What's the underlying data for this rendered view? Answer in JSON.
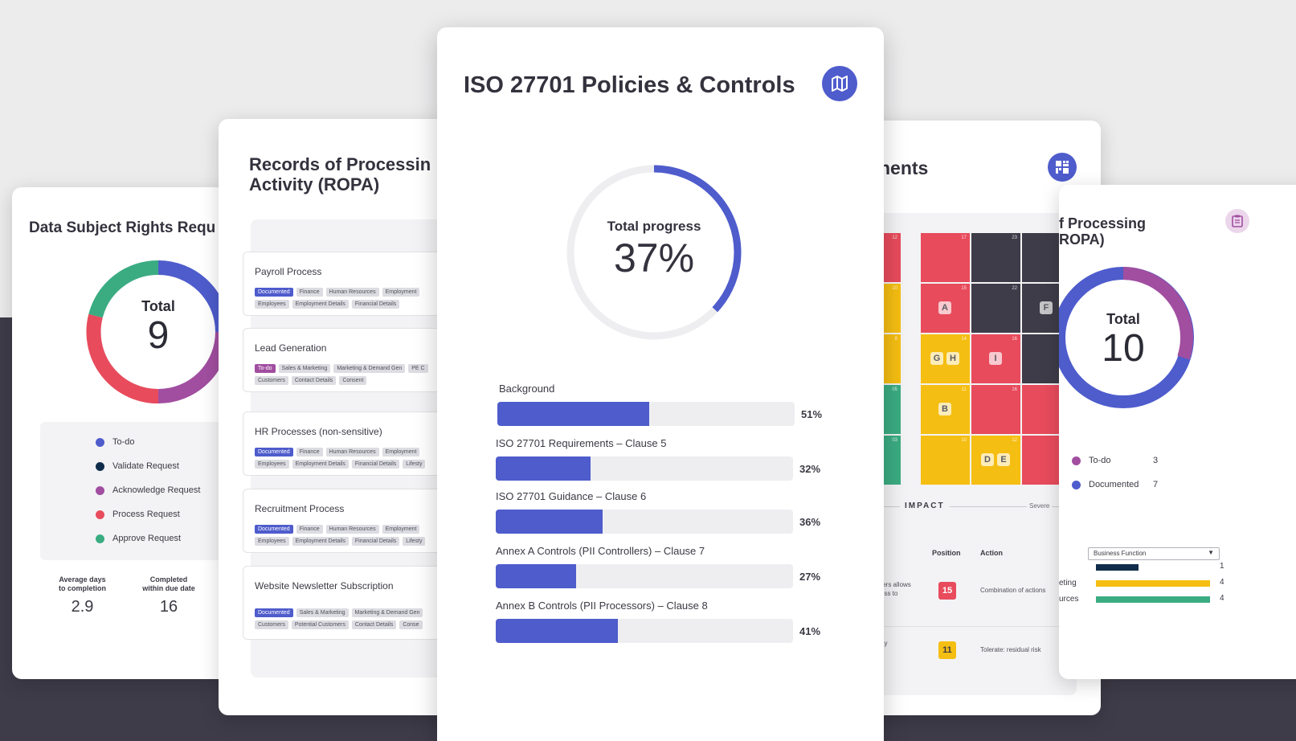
{
  "colors": {
    "accent": "#4e5ccc",
    "purple": "#a14ea0",
    "red": "#e84b5c",
    "green": "#3bac82",
    "navy": "#0f2c4a",
    "yellow": "#f5be12",
    "dark": "#3d3c48"
  },
  "dsr": {
    "title": "Data Subject Rights Requ",
    "total_label": "Total",
    "total_value": "9",
    "legend": [
      {
        "label": "To-do",
        "color": "#4e5ccc"
      },
      {
        "label": "Validate Request",
        "color": "#0f2c4a"
      },
      {
        "label": "Acknowledge Request",
        "color": "#a14ea0"
      },
      {
        "label": "Process Request",
        "color": "#e84b5c"
      },
      {
        "label": "Approve Request",
        "color": "#3bac82"
      }
    ],
    "stats": [
      {
        "label1": "Average days",
        "label2": "to completion",
        "value": "2.9"
      },
      {
        "label1": "Completed",
        "label2": "within due date",
        "value": "16"
      }
    ]
  },
  "ropa": {
    "title_line1": "Records of Processin",
    "title_line2": "Activity (ROPA)",
    "processes": [
      {
        "name": "Payroll Process",
        "row1": [
          "Documented",
          "Finance",
          "Human Resources",
          "Employment"
        ],
        "row2": [
          "Employees",
          "Employment Details",
          "Financial Details"
        ]
      },
      {
        "name": "Lead Generation",
        "row1": [
          "To-do",
          "Sales & Marketing",
          "Marketing & Demand Gen",
          "PE C"
        ],
        "row2": [
          "Customers",
          "Contact Details",
          "Consent"
        ]
      },
      {
        "name": "HR Processes (non-sensitive)",
        "row1": [
          "Documented",
          "Finance",
          "Human Resources",
          "Employment"
        ],
        "row2": [
          "Employees",
          "Employment Details",
          "Financial Details",
          "Lifesty"
        ]
      },
      {
        "name": "Recruitment Process",
        "row1": [
          "Documented",
          "Finance",
          "Human Resources",
          "Employment"
        ],
        "row2": [
          "Employees",
          "Employment Details",
          "Financial Details",
          "Lifesty"
        ]
      },
      {
        "name": "Website Newsletter Subscription",
        "row1": [
          "Documented",
          "Sales & Marketing",
          "Marketing & Demand Gen"
        ],
        "row2": [
          "Customers",
          "Potential Customers",
          "Contact Details",
          "Conse"
        ]
      }
    ]
  },
  "iso": {
    "title": "ISO 27701 Policies & Controls",
    "icon": "map-icon",
    "progress_label": "Total progress",
    "progress_value": "37%",
    "progress_fraction": 0.37,
    "bars": [
      {
        "label": "Background",
        "value": 51,
        "display": "51%"
      },
      {
        "label": "ISO 27701 Requirements – Clause 5",
        "value": 32,
        "display": "32%"
      },
      {
        "label": "ISO 27701 Guidance – Clause 6",
        "value": 36,
        "display": "36%"
      },
      {
        "label": "Annex A Controls (PII Controllers) – Clause 7",
        "value": 27,
        "display": "27%"
      },
      {
        "label": "Annex B Controls (PII Processors) – Clause 8",
        "value": 41,
        "display": "41%"
      }
    ]
  },
  "risk": {
    "title": "nents",
    "icon": "grid-icon",
    "grid": [
      [
        {
          "c": "red",
          "n": "12"
        },
        {
          "c": "red",
          "n": "17"
        },
        {
          "c": "dark",
          "n": "23"
        },
        {
          "c": "dark",
          "n": "25"
        }
      ],
      [
        {
          "c": "yellow",
          "n": "10"
        },
        {
          "c": "red",
          "n": "15",
          "l": [
            "A"
          ]
        },
        {
          "c": "dark",
          "n": "22"
        },
        {
          "c": "dark",
          "n": "24",
          "l": [
            "F"
          ]
        }
      ],
      [
        {
          "c": "yellow",
          "n": "8"
        },
        {
          "c": "yellow",
          "n": "14",
          "l": [
            "G",
            "H"
          ]
        },
        {
          "c": "red",
          "n": "16",
          "l": [
            "I"
          ]
        },
        {
          "c": "dark",
          "n": "21"
        }
      ],
      [
        {
          "c": "green",
          "n": "05"
        },
        {
          "c": "yellow",
          "n": "11",
          "l": [
            "B"
          ]
        },
        {
          "c": "red",
          "n": "16"
        },
        {
          "c": "red",
          "n": "20"
        }
      ],
      [
        {
          "c": "green",
          "n": "03"
        },
        {
          "c": "yellow",
          "n": "10"
        },
        {
          "c": "yellow",
          "n": "12",
          "l": [
            "D",
            "E"
          ]
        },
        {
          "c": "red",
          "n": "18"
        }
      ]
    ],
    "axis_label": "IMPACT",
    "axis_end": "Severe",
    "col_position": "Position",
    "col_action": "Action",
    "rows": [
      {
        "desc1": "ters allows",
        "desc2": "ess to",
        "position": "15",
        "color": "#e84b5c",
        "action": "Combination of actions"
      },
      {
        "desc1": "ay",
        "desc2": "",
        "position": "11",
        "color": "#f5be12",
        "action": "Tolerate: residual risk"
      }
    ]
  },
  "ropa2": {
    "title_line1": "f Processing",
    "title_line2": "ROPA)",
    "icon": "clipboard-icon",
    "total_label": "Total",
    "total_value": "10",
    "legend": [
      {
        "label": "To-do",
        "count": "3",
        "color": "#a14ea0"
      },
      {
        "label": "Documented",
        "count": "7",
        "color": "#4e5ccc"
      }
    ],
    "select_value": "Business Function",
    "bars": [
      {
        "label": "",
        "value": 1,
        "color": "#0f2c4a"
      },
      {
        "label": "eting",
        "value": 4,
        "color": "#f5be12"
      },
      {
        "label": "urces",
        "value": 4,
        "color": "#3bac82"
      }
    ]
  }
}
